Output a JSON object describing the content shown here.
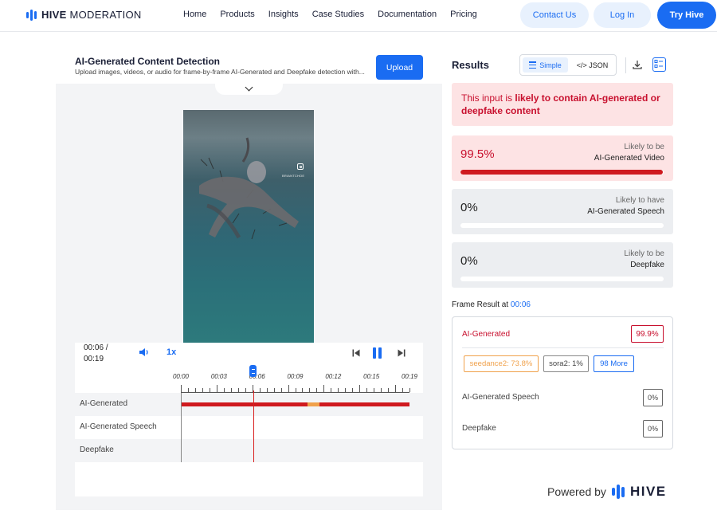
{
  "nav": {
    "logo_bold": "HIVE",
    "logo_light": "MODERATION",
    "links": [
      "Home",
      "Products",
      "Insights",
      "Case Studies",
      "Documentation",
      "Pricing"
    ],
    "contact_label": "Contact Us",
    "login_label": "Log In",
    "try_label": "Try Hive",
    "accent_color": "#1a6cf2"
  },
  "detector": {
    "title": "AI-Generated Content Detection",
    "subtitle": "Upload images, videos, or audio for frame-by-frame AI-Generated and Deepfake detection with...",
    "upload_label": "Upload",
    "watermark_handle": "BRIANTCHOE"
  },
  "player": {
    "current_time": "00:06 /",
    "total_time": "00:19",
    "speed": "1x",
    "progress_fraction": 0.316,
    "tick_labels": [
      "00:00",
      "00:03",
      "00:06",
      "00:09",
      "00:12",
      "00:15",
      "00:19"
    ],
    "rows": [
      {
        "label": "AI-Generated",
        "has_track": true
      },
      {
        "label": "AI-Generated Speech",
        "has_track": false
      },
      {
        "label": "Deepfake",
        "has_track": false
      }
    ],
    "orange_segment": {
      "start_seconds": 10.5,
      "end_seconds": 11.5
    }
  },
  "results": {
    "title": "Results",
    "toggle_simple": "Simple",
    "toggle_json": "</> JSON",
    "alert_prefix": "This input is ",
    "alert_emphasis": "likely to contain AI-generated or deepfake content",
    "cards": [
      {
        "pct": "99.5%",
        "value": 0.995,
        "label1": "Likely to be",
        "label2": "AI-Generated Video"
      },
      {
        "pct": "0%",
        "value": 0,
        "label1": "Likely to have",
        "label2": "AI-Generated Speech"
      },
      {
        "pct": "0%",
        "value": 0,
        "label1": "Likely to be",
        "label2": "Deepfake"
      }
    ],
    "alert_color": "#c8102e"
  },
  "frame": {
    "label": "Frame Result at ",
    "time": "00:06",
    "ai_label": "AI-Generated",
    "ai_pct": "99.9%",
    "chip_seedance": "seedance2: 73.8%",
    "chip_sora": "sora2: 1%",
    "chip_more": "98 More",
    "speech_label": "AI-Generated Speech",
    "speech_pct": "0%",
    "deepfake_label": "Deepfake",
    "deepfake_pct": "0%"
  },
  "footer": {
    "powered_by": "Powered by",
    "brand": "HIVE"
  }
}
